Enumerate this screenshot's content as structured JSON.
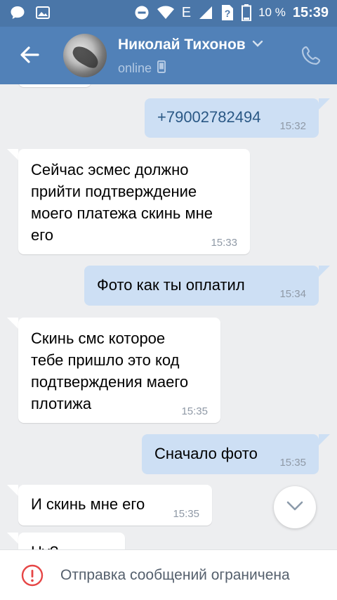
{
  "status_bar": {
    "network": "E",
    "battery_percent": "10 %",
    "time": "15:39"
  },
  "header": {
    "contact_name": "Николай Тихонов",
    "status": "online"
  },
  "messages": [
    {
      "direction": "out",
      "text": "+79002782494",
      "time": "15:32"
    },
    {
      "direction": "in",
      "lines": [
        "Сейчас эсмес должно",
        "прийти подтверждение",
        "моего платежа скинь мне",
        "его"
      ],
      "time": "15:33"
    },
    {
      "direction": "out",
      "text": "Фото как ты оплатил",
      "time": "15:34"
    },
    {
      "direction": "in",
      "lines": [
        "Скинь смс которое",
        "тебе пришло это код",
        "подтверждения маего",
        "плотижа"
      ],
      "time": "15:35"
    },
    {
      "direction": "out",
      "text": "Сначало фото",
      "time": "15:35"
    },
    {
      "direction": "in",
      "text": "И скинь мне его",
      "time": "15:35"
    },
    {
      "direction": "in",
      "text": "Ну?",
      "time": ""
    }
  ],
  "footer": {
    "restriction_text": "Отправка сообщений ограничена"
  },
  "colors": {
    "header": "#5181b8",
    "status_bar": "#4a76a8",
    "outgoing_bubble": "#cddff4",
    "incoming_bubble": "#ffffff",
    "background": "#edeef0",
    "warning": "#e64646"
  },
  "icons": [
    "chat-icon",
    "image-icon",
    "do-not-disturb-icon",
    "wifi-icon",
    "signal-icon",
    "no-sim-icon",
    "battery-icon",
    "back-arrow-icon",
    "chevron-down-icon",
    "mobile-icon",
    "phone-icon",
    "scroll-down-icon",
    "warning-icon"
  ]
}
